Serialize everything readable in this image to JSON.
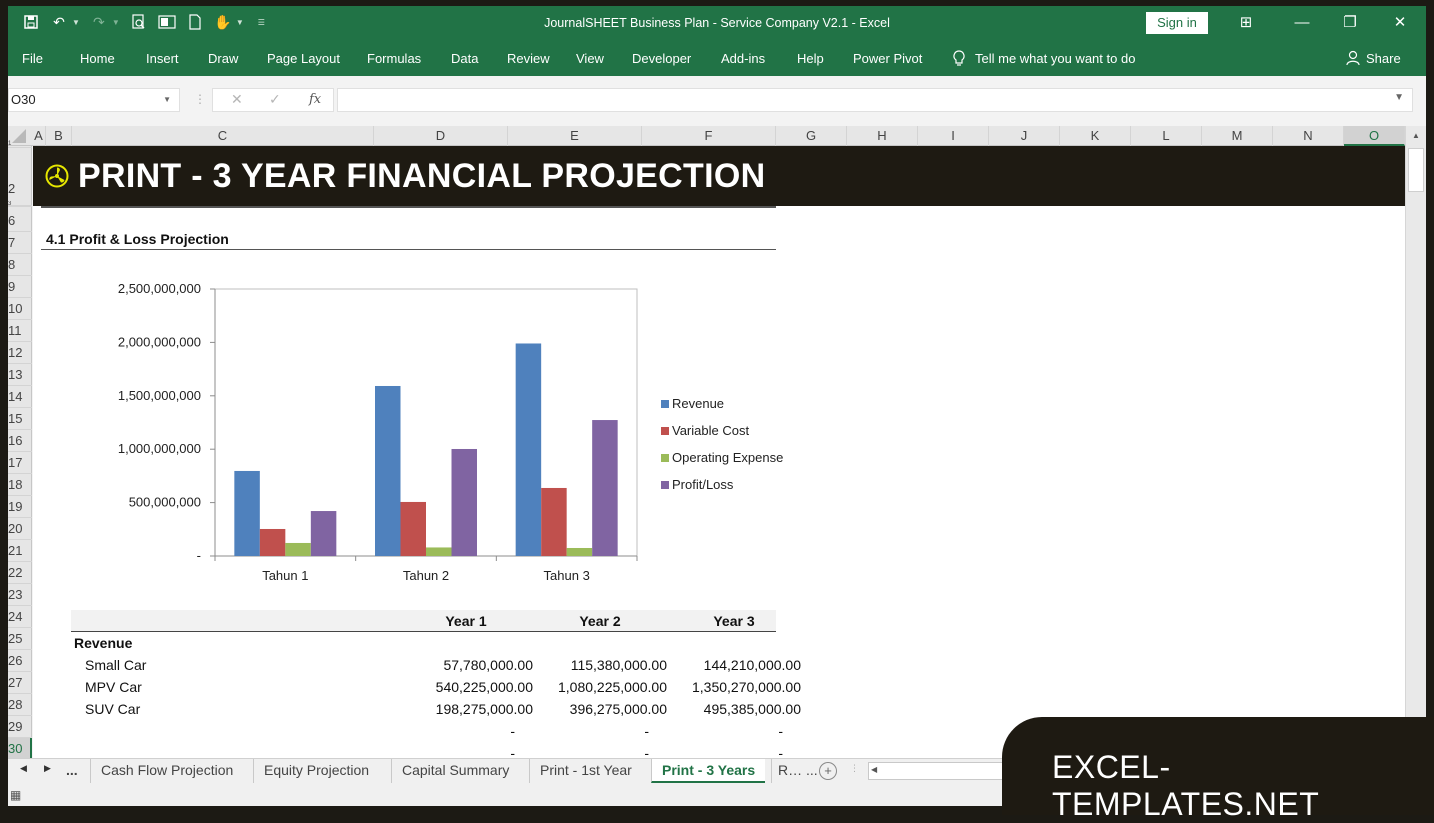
{
  "window": {
    "title": "JournalSHEET Business Plan - Service Company V2.1  -  Excel",
    "sign_in": "Sign in",
    "controls": [
      "ribbon-display-options",
      "minimize",
      "restore",
      "close"
    ]
  },
  "quick_access": [
    {
      "icon": "save-icon"
    },
    {
      "icon": "undo-icon"
    },
    {
      "icon": "redo-icon"
    },
    {
      "icon": "print-preview-icon"
    },
    {
      "icon": "outlook-icon"
    },
    {
      "icon": "new-document-icon"
    },
    {
      "icon": "touch-mode-icon"
    },
    {
      "icon": "customize-qat-icon"
    }
  ],
  "ribbon": {
    "tabs": [
      "File",
      "Home",
      "Insert",
      "Draw",
      "Page Layout",
      "Formulas",
      "Data",
      "Review",
      "View",
      "Developer",
      "Add-ins",
      "Help",
      "Power Pivot"
    ],
    "tell_me": "Tell me what you want to do",
    "share": "Share"
  },
  "formula_bar": {
    "name_box": "O30",
    "fx": "fx",
    "formula": ""
  },
  "columns": [
    "A",
    "B",
    "C",
    "D",
    "E",
    "F",
    "G",
    "H",
    "I",
    "J",
    "K",
    "L",
    "M",
    "N",
    "O"
  ],
  "selected_column": "O",
  "rows": [
    "1",
    "2",
    "3",
    "6",
    "7",
    "8",
    "9",
    "10",
    "11",
    "12",
    "13",
    "14",
    "15",
    "16",
    "17",
    "18",
    "19",
    "20",
    "21",
    "22",
    "23",
    "24",
    "25",
    "26",
    "27",
    "28",
    "29",
    "30"
  ],
  "selected_row": "30",
  "sheet": {
    "banner_title": "PRINT - 3 YEAR FINANCIAL PROJECTION",
    "section_title": "4.1  Profit & Loss Projection",
    "table": {
      "headers": [
        "",
        "Year 1",
        "Year 2",
        "Year 3"
      ],
      "rows": [
        {
          "label": "Revenue",
          "bold": true,
          "values": [
            "",
            "",
            ""
          ]
        },
        {
          "label": "Small Car",
          "values": [
            "57,780,000.00",
            "115,380,000.00",
            "144,210,000.00"
          ]
        },
        {
          "label": "MPV Car",
          "values": [
            "540,225,000.00",
            "1,080,225,000.00",
            "1,350,270,000.00"
          ]
        },
        {
          "label": "SUV Car",
          "values": [
            "198,275,000.00",
            "396,275,000.00",
            "495,385,000.00"
          ]
        },
        {
          "label": "",
          "values": [
            "-",
            "-",
            "-"
          ]
        },
        {
          "label": "",
          "values": [
            "-",
            "-",
            "-"
          ]
        }
      ]
    }
  },
  "chart_data": {
    "type": "bar",
    "title": "",
    "xlabel": "",
    "ylabel": "",
    "categories": [
      "Tahun 1",
      "Tahun 2",
      "Tahun 3"
    ],
    "series": [
      {
        "name": "Revenue",
        "color": "#4f81bd",
        "values": [
          796280000,
          1591880000,
          1989865000
        ]
      },
      {
        "name": "Variable Cost",
        "color": "#c0504d",
        "values": [
          253000000,
          506000000,
          637000000
        ]
      },
      {
        "name": "Operating Expenses",
        "color": "#9bbb59",
        "values": [
          122000000,
          80000000,
          75000000
        ]
      },
      {
        "name": "Profit/Loss",
        "color": "#8064a2",
        "values": [
          421000000,
          1002000000,
          1273000000
        ]
      }
    ],
    "ylim": [
      0,
      2500000000
    ],
    "yticks": [
      0,
      500000000,
      1000000000,
      1500000000,
      2000000000,
      2500000000
    ],
    "ytick_labels": [
      "-",
      "500,000,000",
      "1,000,000,000",
      "1,500,000,000",
      "2,000,000,000",
      "2,500,000,000"
    ],
    "grid": false,
    "legend_position": "right"
  },
  "sheet_tabs": {
    "overflow": "...",
    "tabs": [
      "Cash Flow Projection",
      "Equity Projection",
      "Capital Summary",
      "Print - 1st Year",
      "Print - 3 Years",
      "R… ..."
    ],
    "active": "Print - 3 Years"
  },
  "watermark": "EXCEL-TEMPLATES.NET"
}
